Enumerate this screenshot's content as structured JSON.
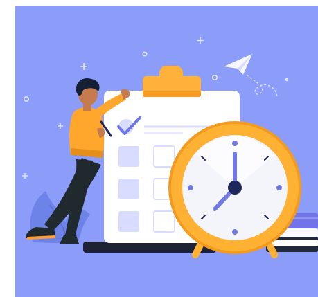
{
  "scene": {
    "subject": "person-with-checklist-and-alarm-clock",
    "icons": [
      "clipboard-icon",
      "check-icon",
      "alarm-clock-icon",
      "paper-plane-icon",
      "books-icon",
      "pen-icon"
    ],
    "colors": {
      "background": "#ffffff",
      "panel": "#8b9cf9",
      "panel_light": "#a7b4ff",
      "clipboard": "#ffffff",
      "clip": "#ffb13b",
      "checkbox": "#d8dcff",
      "check": "#6d78e8",
      "clock_outer": "#ffb133",
      "clock_face": "#f4f5fb",
      "clock_hand": "#7079e4",
      "clock_center": "#1e275c",
      "person_shirt": "#ffa72c",
      "person_pants": "#202a2e",
      "person_skin": "#c57b4d",
      "person_hair": "#152033",
      "books_top": "#7174e8",
      "books_mid": "#fbfbfd",
      "books_bottom": "#1f2937",
      "ground": "#1d2237",
      "bush": "#6d83e8",
      "sparkle": "#ffffff"
    }
  }
}
